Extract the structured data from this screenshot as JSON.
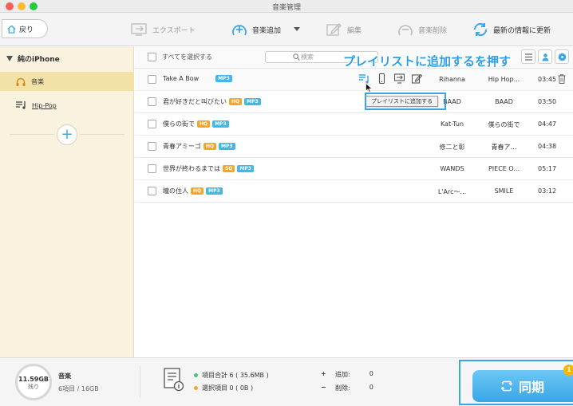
{
  "window": {
    "title": "音楽管理"
  },
  "toolbar": {
    "back_label": "戻り",
    "export_label": "エクスポート",
    "add_music_label": "音楽追加",
    "edit_label": "編集",
    "delete_label": "音楽削除",
    "refresh_label": "最新の情報に更新"
  },
  "sidebar": {
    "device_name": "純のiPhone",
    "items": [
      {
        "label": "音楽",
        "icon": "headphones-icon"
      },
      {
        "label": "Hip-Pop",
        "icon": "playlist-icon"
      }
    ]
  },
  "list": {
    "select_all_label": "すべてを選択する",
    "search_placeholder": "検索",
    "songs": [
      {
        "title": "Take A Bow",
        "badges": [
          "MP3"
        ],
        "artist": "Rihanna",
        "album": "Hip Hop...",
        "duration": "03:45"
      },
      {
        "title": "君が好きだと叫びたい",
        "badges": [
          "HQ",
          "MP3"
        ],
        "artist": "BAAD",
        "album": "BAAD",
        "duration": "03:50"
      },
      {
        "title": "僕らの街で",
        "badges": [
          "HQ",
          "MP3"
        ],
        "artist": "Kat-Tun",
        "album": "僕らの街で",
        "duration": "04:47"
      },
      {
        "title": "青春アミーゴ",
        "badges": [
          "HQ",
          "MP3"
        ],
        "artist": "修二と彰",
        "album": "青春ア…",
        "duration": "04:38"
      },
      {
        "title": "世界が終わるまでは",
        "badges": [
          "SQ",
          "MP3"
        ],
        "artist": "WANDS",
        "album": "PIECE O...",
        "duration": "05:17"
      },
      {
        "title": "瞳の住人",
        "badges": [
          "HQ",
          "MP3"
        ],
        "artist": "L'Arc～...",
        "album": "SMILE",
        "duration": "03:12"
      }
    ]
  },
  "tooltip": {
    "text": "プレイリストに追加する"
  },
  "annotation": {
    "text": "プレイリストに追加するを押す"
  },
  "footer": {
    "storage_free": "11.59GB",
    "storage_free_label": "残り",
    "category": "音楽",
    "count_info": "6項目 / 16GB",
    "total_items": "項目合計 6 ( 35.6MB )",
    "selected_items": "選択項目 0 ( 0B )",
    "add_label": "追加:",
    "add_count": "0",
    "delete_label": "削除:",
    "delete_count": "0",
    "sync_label": "同期",
    "sync_badge": "1"
  },
  "colors": {
    "accent": "#3aa6e8",
    "sidebar_bg": "#f8f2df",
    "sidebar_selected": "#f3e2a8",
    "hq_badge": "#f5a623",
    "mp3_badge": "#42b8e8"
  }
}
